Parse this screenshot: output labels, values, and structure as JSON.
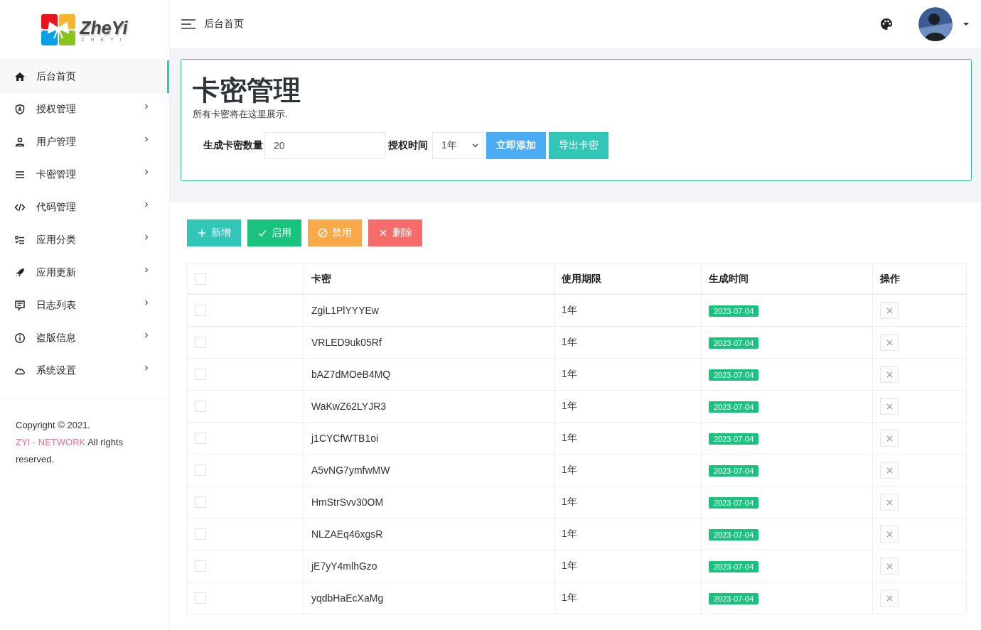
{
  "logo": {
    "name": "ZheYi",
    "tagline": "ZHEYI"
  },
  "sidebar": {
    "items": [
      {
        "label": "后台首页",
        "kind": "home",
        "selected": true,
        "expandable": false
      },
      {
        "label": "授权管理",
        "kind": "shield",
        "selected": false,
        "expandable": true
      },
      {
        "label": "用户管理",
        "kind": "user",
        "selected": false,
        "expandable": true
      },
      {
        "label": "卡密管理",
        "kind": "list",
        "selected": false,
        "expandable": true
      },
      {
        "label": "代码管理",
        "kind": "code",
        "selected": false,
        "expandable": true
      },
      {
        "label": "应用分类",
        "kind": "checklist",
        "selected": false,
        "expandable": true
      },
      {
        "label": "应用更新",
        "kind": "rocket",
        "selected": false,
        "expandable": true
      },
      {
        "label": "日志列表",
        "kind": "comment",
        "selected": false,
        "expandable": true
      },
      {
        "label": "盗版信息",
        "kind": "info",
        "selected": false,
        "expandable": true
      },
      {
        "label": "系统设置",
        "kind": "cloud",
        "selected": false,
        "expandable": true
      }
    ],
    "copyright": {
      "before": "Copyright © 2021.",
      "link": "ZYI - NETWORK",
      "after": "All rights reserved."
    }
  },
  "header": {
    "breadcrumb": "后台首页"
  },
  "card": {
    "title": "卡密管理",
    "subtitle": "所有卡密将在这里展示.",
    "count_label": "生成卡密数量",
    "count_value": "20",
    "time_label": "授权时间",
    "time_value": "1年",
    "buttons": [
      {
        "label": "立即添加",
        "kind": "primary"
      },
      {
        "label": "导出卡密",
        "kind": "export"
      }
    ]
  },
  "toolbar": [
    {
      "label": "新增",
      "kind": "add"
    },
    {
      "label": "启用",
      "kind": "enable"
    },
    {
      "label": "禁用",
      "kind": "disable"
    },
    {
      "label": "删除",
      "kind": "delete"
    }
  ],
  "table": {
    "header_checked": false,
    "columns": [
      "卡密",
      "使用期限",
      "生成时间",
      "操作"
    ],
    "rows": [
      {
        "key": "ZgiL1PlYYYEw",
        "period": "1年",
        "date": "2023-07-04",
        "checked": false
      },
      {
        "key": "VRLED9uk05Rf",
        "period": "1年",
        "date": "2023-07-04",
        "checked": false
      },
      {
        "key": "bAZ7dMOeB4MQ",
        "period": "1年",
        "date": "2023-07-04",
        "checked": false
      },
      {
        "key": "WaKwZ62LYJR3",
        "period": "1年",
        "date": "2023-07-04",
        "checked": false
      },
      {
        "key": "j1CYCfWTB1oi",
        "period": "1年",
        "date": "2023-07-04",
        "checked": false
      },
      {
        "key": "A5vNG7ymfwMW",
        "period": "1年",
        "date": "2023-07-04",
        "checked": false
      },
      {
        "key": "HmStrSvv30OM",
        "period": "1年",
        "date": "2023-07-04",
        "checked": false
      },
      {
        "key": "NLZAEq46xgsR",
        "period": "1年",
        "date": "2023-07-04",
        "checked": false
      },
      {
        "key": "jE7yY4mlhGzo",
        "period": "1年",
        "date": "2023-07-04",
        "checked": false
      },
      {
        "key": "yqdbHaEcXaMg",
        "period": "1年",
        "date": "2023-07-04",
        "checked": false
      }
    ]
  }
}
